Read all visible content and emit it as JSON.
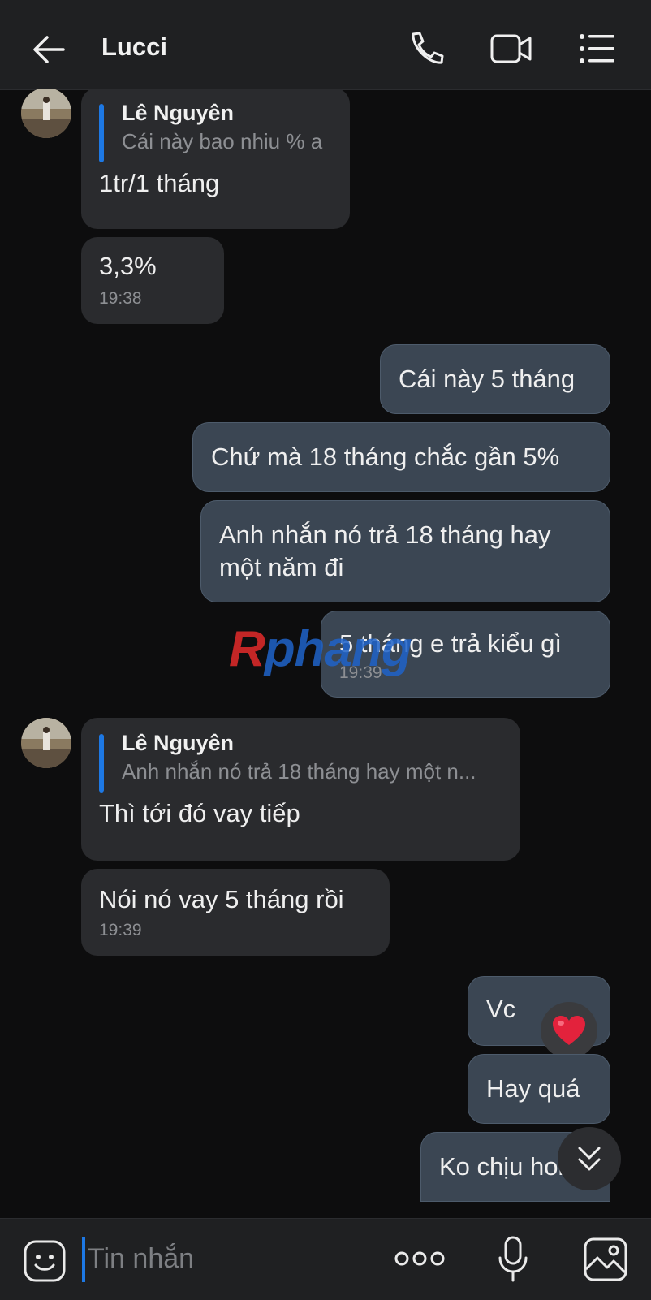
{
  "header": {
    "title": "Lucci",
    "back_icon": "arrow-left-icon",
    "call_icon": "phone-icon",
    "video_icon": "video-camera-icon",
    "menu_icon": "list-menu-icon"
  },
  "messages": {
    "m1": {
      "reply_name": "Lê Nguyên",
      "reply_text": "Cái này bao nhiu % a",
      "text": "1tr/1 tháng"
    },
    "m2": {
      "text": "3,3%",
      "time": "19:38"
    },
    "m3": {
      "text": "Cái này 5 tháng"
    },
    "m4": {
      "text": "Chứ mà 18 tháng chắc gần 5%"
    },
    "m5": {
      "text_line1": "Anh nhắn nó trả 18 tháng hay",
      "text_line2": "một năm đi"
    },
    "m6": {
      "text": "5 tháng e trả kiểu gì",
      "time": "19:39"
    },
    "m7": {
      "reply_name": "Lê Nguyên",
      "reply_text": "Anh nhắn nó trả 18 tháng hay một n...",
      "text": "Thì tới đó vay tiếp"
    },
    "m8": {
      "text": "Nói nó vay 5 tháng rồi",
      "time": "19:39"
    },
    "m9": {
      "text": "Vc",
      "reaction": "heart"
    },
    "m10": {
      "text": "Hay quá"
    },
    "m11": {
      "text": "Ko chịu hoie"
    }
  },
  "watermark": {
    "part1": "R",
    "part2": "phang"
  },
  "composer": {
    "placeholder": "Tin nhắn",
    "emoji_icon": "sticker-icon",
    "more_icon": "more-dots-icon",
    "mic_icon": "microphone-icon",
    "image_icon": "image-icon"
  },
  "colors": {
    "background": "#0d0d0e",
    "incoming_bubble": "#2a2b2e",
    "outgoing_bubble": "#3b4653",
    "accent": "#1d78e4"
  }
}
